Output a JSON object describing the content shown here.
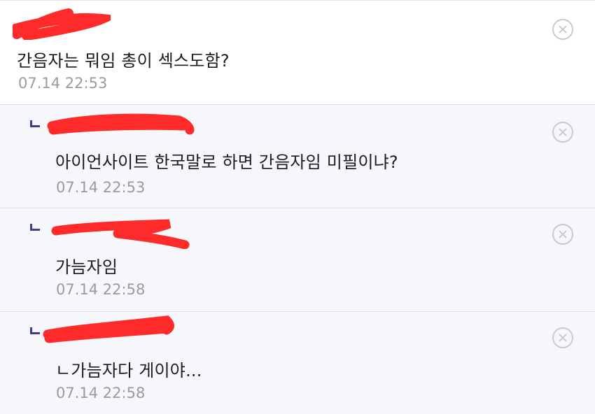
{
  "comments": [
    {
      "kind": "comment",
      "author_redacted": true,
      "text": "간음자는 뭐임 총이 섹스도함?",
      "time": "07.14 22:53"
    },
    {
      "kind": "reply",
      "author_redacted": true,
      "text": "아이언사이트 한국말로 하면 간음자임 미필이냐?",
      "time": "07.14 22:53"
    },
    {
      "kind": "reply",
      "author_redacted": true,
      "text": "가늠자임",
      "time": "07.14 22:58"
    },
    {
      "kind": "reply",
      "author_redacted": true,
      "text": "ㄴ가늠자다 게이야...",
      "time": "07.14 22:58"
    }
  ],
  "icons": {
    "delete": "close-circle-icon",
    "reply": "reply-corner-icon"
  },
  "colors": {
    "reply_background": "#f6f7fb",
    "reply_mark": "#3b3f8f",
    "redaction": "#ff2a2a",
    "timestamp": "#9a9aa2",
    "divider": "#dcdde4"
  }
}
